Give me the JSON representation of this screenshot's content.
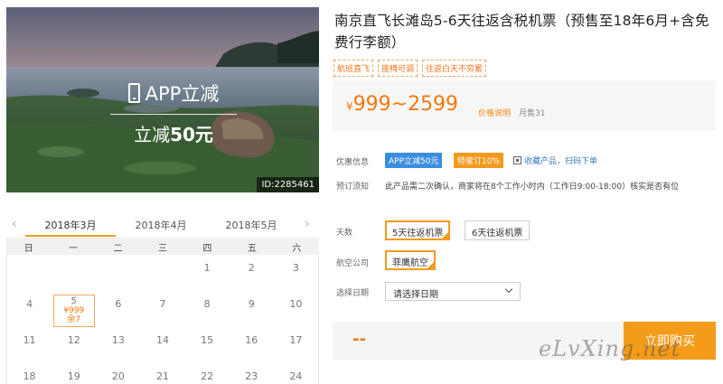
{
  "hero": {
    "promo_top": "APP立减",
    "promo_bottom_prefix": "立减",
    "promo_bottom_amount": "50元",
    "image_id": "ID:2285461"
  },
  "calendar": {
    "prev_arrow": "‹",
    "next_arrow": "›",
    "months": [
      "2018年3月",
      "2018年4月",
      "2018年5月"
    ],
    "weekdays": [
      "日",
      "一",
      "二",
      "三",
      "四",
      "五",
      "六"
    ],
    "days": [
      "",
      "",
      "",
      "",
      "1",
      "2",
      "3",
      "4",
      "5",
      "6",
      "7",
      "8",
      "9",
      "10",
      "11",
      "12",
      "13",
      "14",
      "15",
      "16",
      "17",
      "18",
      "19",
      "20",
      "21",
      "22",
      "23",
      "24"
    ],
    "selected": {
      "day": "5",
      "price": "¥999",
      "left": "余7"
    }
  },
  "product": {
    "title": "南京直飞长滩岛5-6天往返含税机票（预售至18年6月+含免费行李额）",
    "tags": [
      "航班直飞",
      "座椅可调",
      "往返白天不穷累"
    ],
    "price": {
      "symbol": "¥",
      "range": "999~2599",
      "link": "价格说明",
      "sales": "月售31"
    }
  },
  "info": {
    "promo_label": "优惠信息",
    "promo_badges": [
      "APP立减50元",
      "特蜜订10%"
    ],
    "fav_text": "收藏产品，扫码下单",
    "notice_label": "预订须知",
    "notice_text": "此产品需二次确认，商家将在8个工作小时内（工作日9:00-18:00）核实是否有位"
  },
  "options": {
    "days_label": "天数",
    "days": [
      "5天往返机票",
      "6天往返机票"
    ],
    "airline_label": "航空公司",
    "airline": "菲鹰航空",
    "date_label": "选择日期",
    "date_placeholder": "请选择日期"
  },
  "buy": {
    "price": "--",
    "button": "立即购买"
  },
  "watermark": "eLvXing.net",
  "colors": {
    "accent": "#f39a1f",
    "price": "#f3780c",
    "promo_badge": "#3c8ddf",
    "discount_badge": "#f39a1f"
  }
}
